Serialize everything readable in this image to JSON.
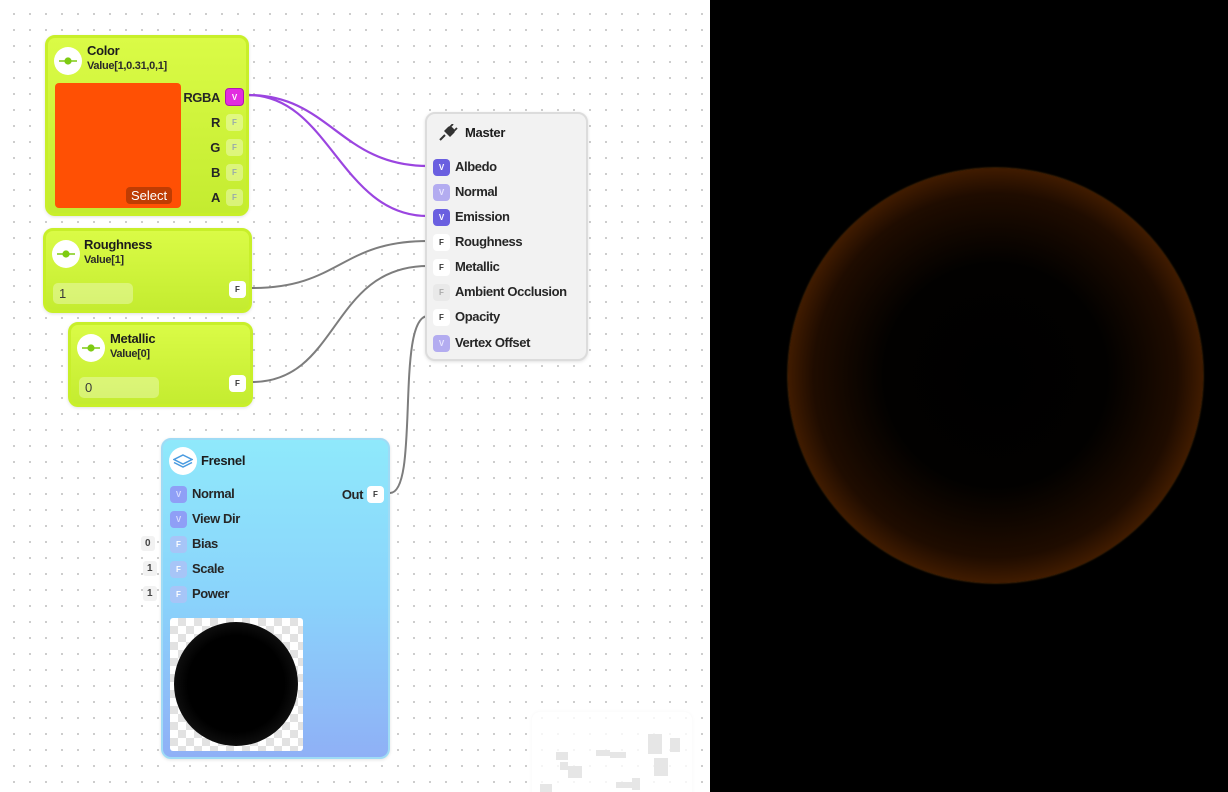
{
  "colors": {
    "node_green": "#d4f53a",
    "fresnel_blue": "#8fe9fb",
    "wire_purple": "#9b45e0",
    "wire_gray": "#7a7a7a",
    "swatch": "#ff5004",
    "preview_bg": "#000000",
    "rim": "#d77510"
  },
  "nodes": {
    "color": {
      "icon": "slider-icon",
      "title": "Color",
      "subtitle": "Value[1,0.31,0,1]",
      "select_label": "Select",
      "outputs": [
        {
          "label": "RGBA",
          "type": "V"
        },
        {
          "label": "R",
          "type": "F"
        },
        {
          "label": "G",
          "type": "F"
        },
        {
          "label": "B",
          "type": "F"
        },
        {
          "label": "A",
          "type": "F"
        }
      ]
    },
    "roughness": {
      "icon": "slider-icon",
      "title": "Roughness",
      "subtitle": "Value[1]",
      "value": "1",
      "output_type": "F"
    },
    "metallic": {
      "icon": "slider-icon",
      "title": "Metallic",
      "subtitle": "Value[0]",
      "value": "0",
      "output_type": "F"
    },
    "master": {
      "icon": "plug-icon",
      "title": "Master",
      "inputs": [
        {
          "label": "Albedo",
          "type": "V"
        },
        {
          "label": "Normal",
          "type": "V"
        },
        {
          "label": "Emission",
          "type": "V"
        },
        {
          "label": "Roughness",
          "type": "F"
        },
        {
          "label": "Metallic",
          "type": "F"
        },
        {
          "label": "Ambient Occlusion",
          "type": "F"
        },
        {
          "label": "Opacity",
          "type": "F"
        },
        {
          "label": "Vertex Offset",
          "type": "V"
        }
      ]
    },
    "fresnel": {
      "icon": "layers-icon",
      "title": "Fresnel",
      "output": {
        "label": "Out",
        "type": "F"
      },
      "inputs": [
        {
          "label": "Normal",
          "type": "V",
          "default": ""
        },
        {
          "label": "View Dir",
          "type": "V",
          "default": ""
        },
        {
          "label": "Bias",
          "type": "F",
          "default": "0"
        },
        {
          "label": "Scale",
          "type": "F",
          "default": "1"
        },
        {
          "label": "Power",
          "type": "F",
          "default": "1"
        }
      ]
    }
  }
}
